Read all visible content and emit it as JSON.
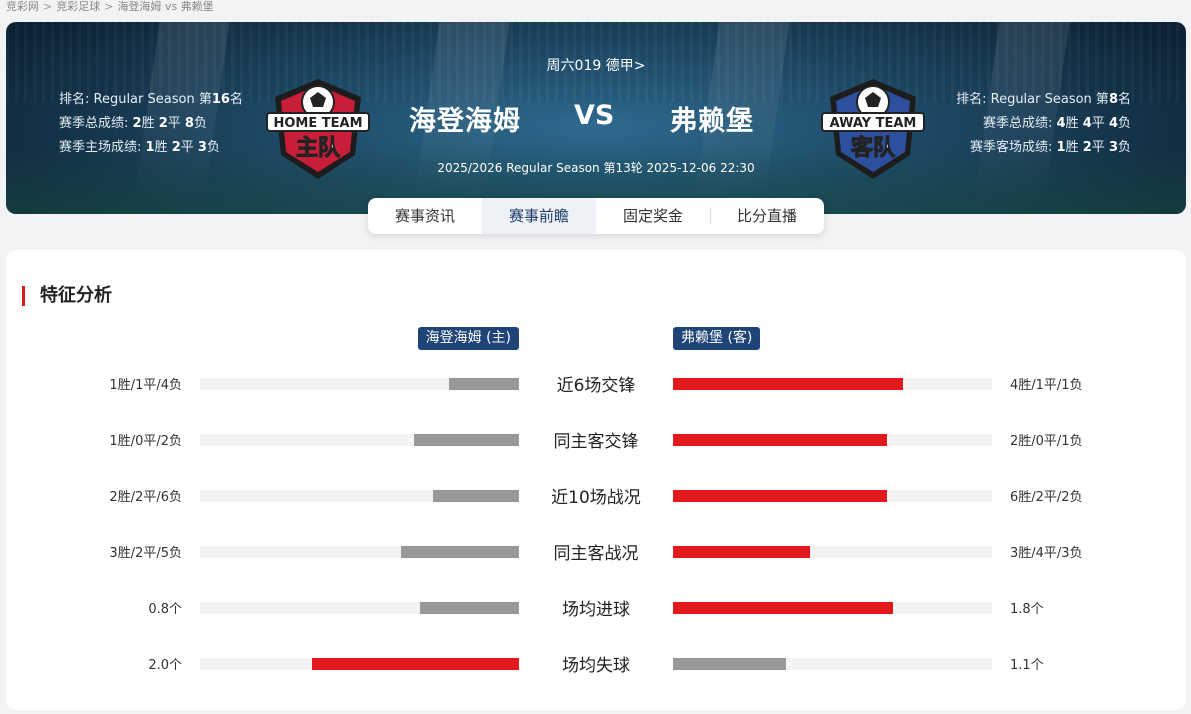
{
  "breadcrumb": {
    "items": [
      "竞彩网",
      "竞彩足球",
      "海登海姆 vs 弗赖堡"
    ],
    "separator": ">"
  },
  "match": {
    "code_league": "周六019 德甲>",
    "home_name": "海登海姆",
    "away_name": "弗赖堡",
    "vs": "VS",
    "info": "2025/2026 Regular Season 第13轮 2025-12-06 22:30"
  },
  "home": {
    "rank_prefix": "排名: Regular Season 第",
    "rank": "16",
    "rank_suffix": "名",
    "total_label": "赛季总成绩: ",
    "total": {
      "w": "2",
      "d": "2",
      "l": "8"
    },
    "venue_label": "赛季主场成绩: ",
    "venue": {
      "w": "1",
      "d": "2",
      "l": "3"
    },
    "badge_top": "HOME TEAM",
    "badge_bottom": "主队",
    "badge_color": "#c81e3a"
  },
  "away": {
    "rank_prefix": "排名: Regular Season 第",
    "rank": "8",
    "rank_suffix": "名",
    "total_label": "赛季总成绩: ",
    "total": {
      "w": "4",
      "d": "4",
      "l": "4"
    },
    "venue_label": "赛季客场成绩: ",
    "venue": {
      "w": "1",
      "d": "2",
      "l": "3"
    },
    "badge_top": "AWAY TEAM",
    "badge_bottom": "客队",
    "badge_color": "#2c4f9e"
  },
  "labels": {
    "win": "胜",
    "draw": "平",
    "loss": "负"
  },
  "tabs": [
    {
      "label": "赛事资讯",
      "active": false
    },
    {
      "label": "赛事前瞻",
      "active": true
    },
    {
      "label": "固定奖金",
      "active": false
    },
    {
      "label": "比分直播",
      "active": false
    }
  ],
  "section": {
    "title": "特征分析",
    "home_tag": "海登海姆 (主)",
    "away_tag": "弗赖堡 (客)"
  },
  "colors": {
    "highlight": "#e0191d",
    "neutral": "#999999",
    "tag": "#1f4478"
  },
  "features": [
    {
      "label": "近6场交锋",
      "home_text": "1胜/1平/4负",
      "away_text": "4胜/1平/1负",
      "home_ratio": 0.22,
      "away_ratio": 0.72,
      "highlight": "away"
    },
    {
      "label": "同主客交锋",
      "home_text": "1胜/0平/2负",
      "away_text": "2胜/0平/1负",
      "home_ratio": 0.33,
      "away_ratio": 0.67,
      "highlight": "away"
    },
    {
      "label": "近10场战况",
      "home_text": "2胜/2平/6负",
      "away_text": "6胜/2平/2负",
      "home_ratio": 0.27,
      "away_ratio": 0.67,
      "highlight": "away"
    },
    {
      "label": "同主客战况",
      "home_text": "3胜/2平/5负",
      "away_text": "3胜/4平/3负",
      "home_ratio": 0.37,
      "away_ratio": 0.43,
      "highlight": "away"
    },
    {
      "label": "场均进球",
      "home_text": "0.8个",
      "away_text": "1.8个",
      "home_ratio": 0.31,
      "away_ratio": 0.69,
      "highlight": "away"
    },
    {
      "label": "场均失球",
      "home_text": "2.0个",
      "away_text": "1.1个",
      "home_ratio": 0.65,
      "away_ratio": 0.355,
      "highlight": "home"
    }
  ]
}
